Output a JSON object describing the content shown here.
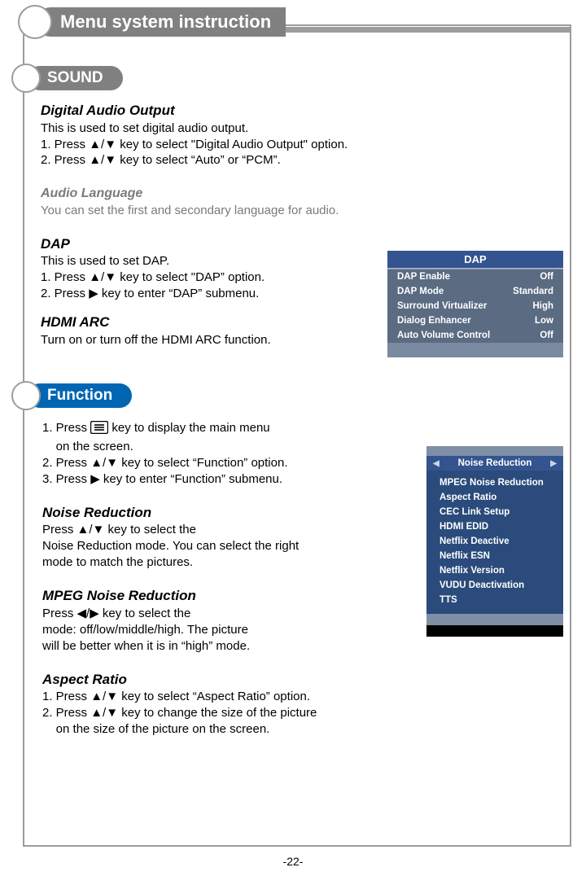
{
  "page_number": "-22-",
  "main_title": "Menu system instruction",
  "section_sound": "SOUND",
  "section_function": "Function",
  "sound": {
    "digital_audio_output": {
      "title": "Digital Audio Output",
      "desc": "This is used to  set  digital  audio  output.",
      "line1_pre": "1. Press ",
      "line1_post": " key to select \"Digital  Audio  Output\" option.",
      "line2_pre": "2. Press ",
      "line2_post": " key to select  “Auto” or “PCM”."
    },
    "audio_language": {
      "title": "Audio Language",
      "desc": "You can set the first and secondary language for audio."
    },
    "dap": {
      "title": "DAP",
      "desc": "This is used to  set  DAP.",
      "line1_pre": "1. Press ",
      "line1_post": " key to select \"DAP” option.",
      "line2_pre": "2. Press ",
      "line2_post": " key to enter “DAP” submenu."
    },
    "hdmi_arc": {
      "title": "HDMI ARC",
      "desc": "Turn on or turn off the HDMI ARC function."
    }
  },
  "dap_panel": {
    "header": "DAP",
    "rows": [
      {
        "label": "DAP Enable",
        "value": "Off"
      },
      {
        "label": "DAP Mode",
        "value": "Standard"
      },
      {
        "label": "Surround Virtualizer",
        "value": "High"
      },
      {
        "label": "Dialog Enhancer",
        "value": "Low"
      },
      {
        "label": "Auto Volume Control",
        "value": "Off"
      }
    ]
  },
  "function": {
    "line1_pre": "1. Press ",
    "line1_post": " key to display the main menu",
    "line1_cont": "    on the screen.",
    "line2_pre": "2. Press  ",
    "line2_post": " key to select “Function” option.",
    "line3_pre": "3. Press ",
    "line3_post": " key to enter “Function” submenu.",
    "noise_reduction": {
      "title": "Noise Reduction",
      "l1_pre": "Press ",
      "l1_post": " key to select the",
      "l2": "Noise Reduction mode. You can select the right",
      "l3": "mode to match the pictures."
    },
    "mpeg": {
      "title": "MPEG Noise Reduction",
      "l1_pre": "Press ",
      "l1_post": " key to select the",
      "l2": "mode: off/low/middle/high. The picture",
      "l3": "will be better when it is in “high” mode."
    },
    "aspect": {
      "title": "Aspect Ratio",
      "l1_pre": "1. Press ",
      "l1_post": " key to select “Aspect Ratio”  option.",
      "l2_pre": "2. Press ",
      "l2_post": " key to change the size of the picture",
      "l3": "    on the size of the picture on the screen."
    }
  },
  "func_panel": {
    "header": "Noise Reduction",
    "items": [
      "MPEG Noise Reduction",
      "Aspect Ratio",
      "CEC Link Setup",
      "HDMI EDID",
      "Netflix Deactive",
      "Netflix ESN",
      "Netflix Version",
      "VUDU Deactivation",
      "TTS"
    ]
  },
  "glyphs": {
    "updown": "▲/▼",
    "right": "▶",
    "leftright": "◀/▶",
    "tri_left": "◀",
    "tri_right": "▶"
  }
}
